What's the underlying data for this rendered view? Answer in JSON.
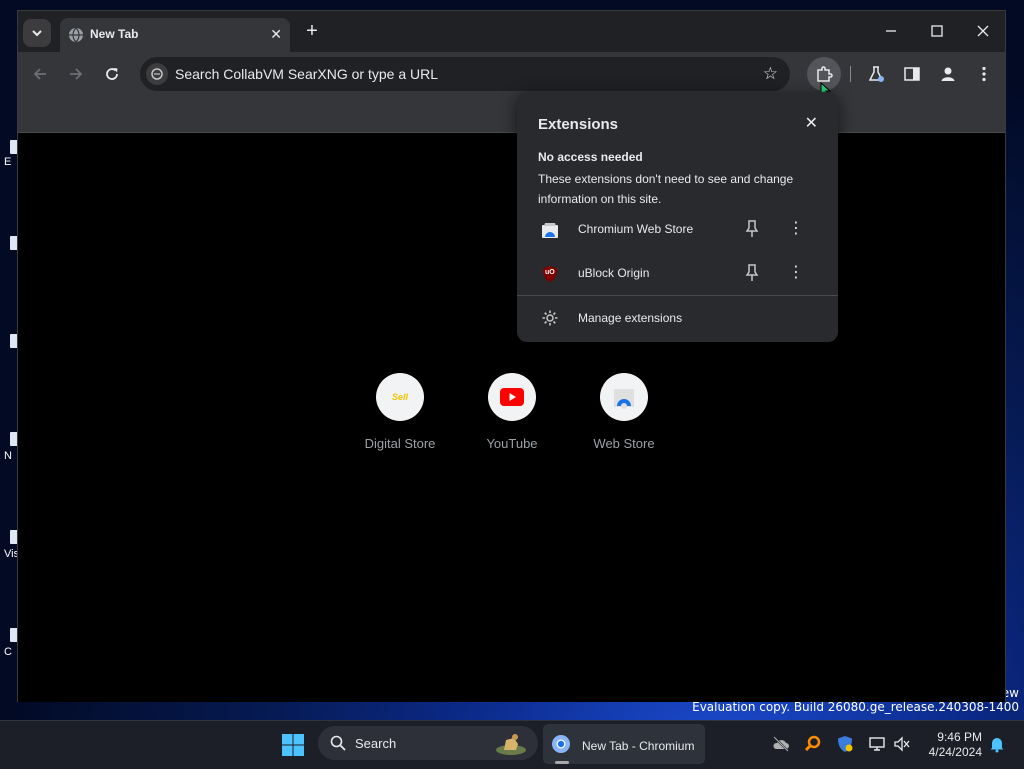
{
  "browser": {
    "tab_title": "New Tab",
    "omnibox_placeholder": "Search CollabVM SearXNG or type a URL"
  },
  "shortcuts": [
    {
      "label": "Digital Store",
      "icon_text": "Sell"
    },
    {
      "label": "YouTube"
    },
    {
      "label": "Web Store"
    }
  ],
  "extensions_popup": {
    "title": "Extensions",
    "subtitle": "No access needed",
    "description": "These extensions don't need to see and change information on this site.",
    "items": [
      {
        "name": "Chromium Web Store"
      },
      {
        "name": "uBlock Origin",
        "icon_text": "uO"
      }
    ],
    "manage_label": "Manage extensions"
  },
  "desktop": {
    "watermark_top": "ew",
    "watermark": "Evaluation copy. Build 26080.ge_release.240308-1400",
    "icon_labels": [
      "E",
      "N",
      "Vis",
      "C"
    ]
  },
  "taskbar": {
    "search_label": "Search",
    "app_label": "New Tab - Chromium",
    "time": "9:46 PM",
    "date": "4/24/2024"
  },
  "colors": {
    "accent_blue": "#1a73e8",
    "youtube_red": "#ff0000",
    "ublock_red": "#800000"
  }
}
